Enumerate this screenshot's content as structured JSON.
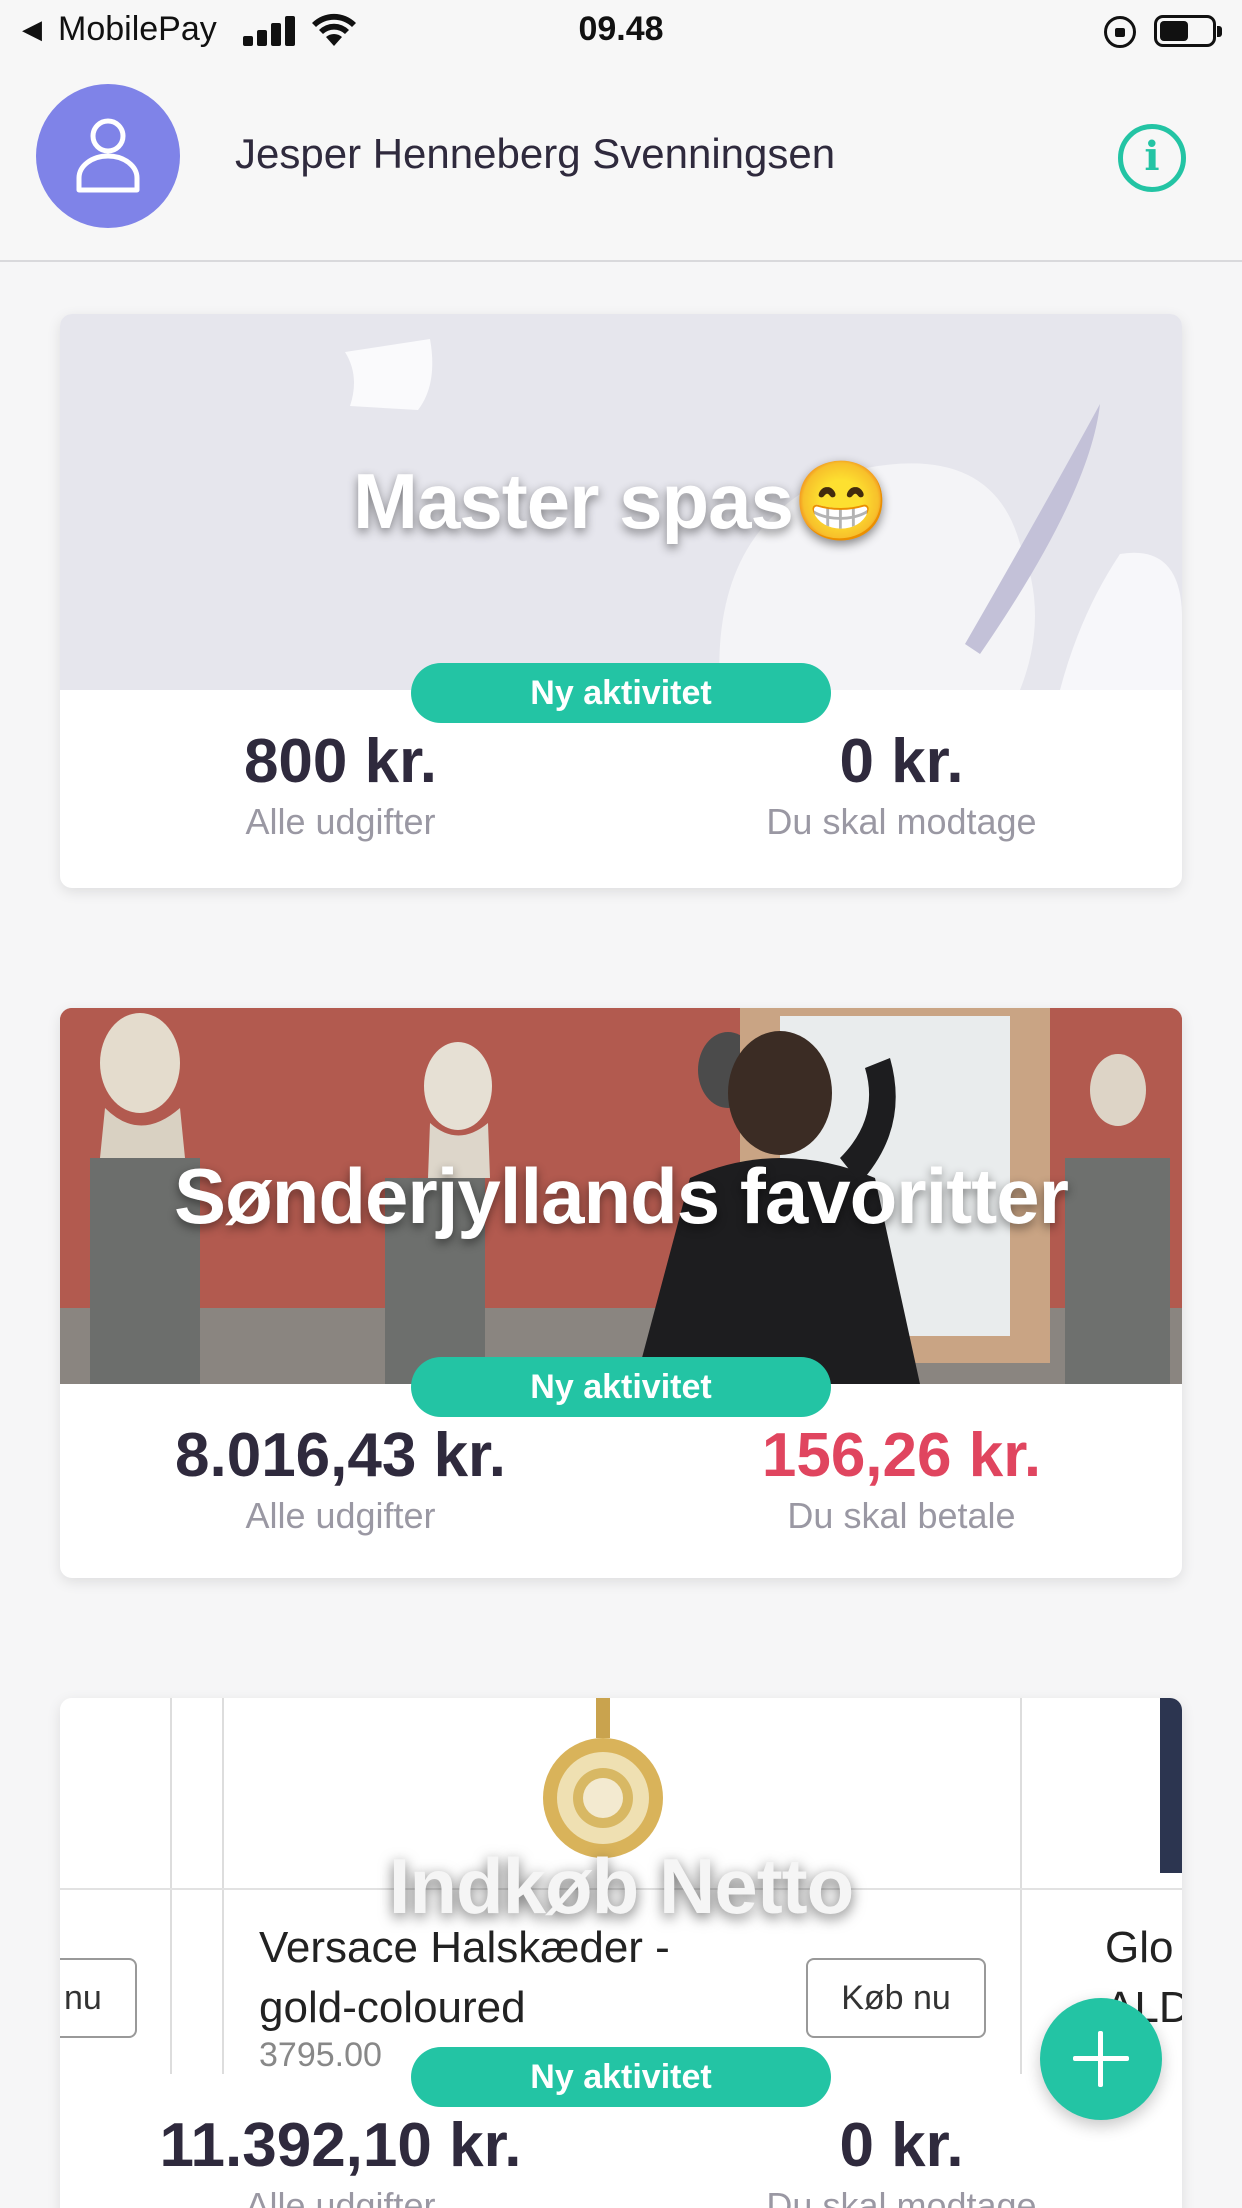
{
  "status_bar": {
    "back_label": "◀",
    "carrier": "MobilePay",
    "time": "09.48",
    "battery_level": 0.55
  },
  "header": {
    "user_name": "Jesper Henneberg Svenningsen"
  },
  "groups": [
    {
      "title": "Master spas😁",
      "badge": "Ny aktivitet",
      "total_amount": "800 kr.",
      "total_label": "Alle udgifter",
      "balance_amount": "0 kr.",
      "balance_label": "Du skal modtage"
    },
    {
      "title": "Sønderjyllands favoritter",
      "badge": "Ny aktivitet",
      "total_amount": "8.016,43 kr.",
      "total_label": "Alle udgifter",
      "balance_amount": "156,26 kr.",
      "balance_label": "Du skal betale"
    },
    {
      "title": "Indkøb Netto",
      "badge": "Ny aktivitet",
      "total_amount": "11.392,10 kr.",
      "total_label": "Alle udgifter",
      "balance_amount": "0 kr.",
      "balance_label": "Du skal modtage",
      "banner_products": {
        "left_button": "nu",
        "product_name_line1": "Versace Halskæder -",
        "product_name_line2": "gold-coloured",
        "product_price": "3795.00",
        "buy_button": "Køb nu",
        "right_text_line1": "Glo",
        "right_text_line2": "ALD"
      }
    }
  ],
  "colors": {
    "accent": "#23c4a4",
    "avatar": "#7f83e8",
    "negative": "#e0455f",
    "text": "#2f2a3d",
    "muted": "#9a98a3"
  }
}
